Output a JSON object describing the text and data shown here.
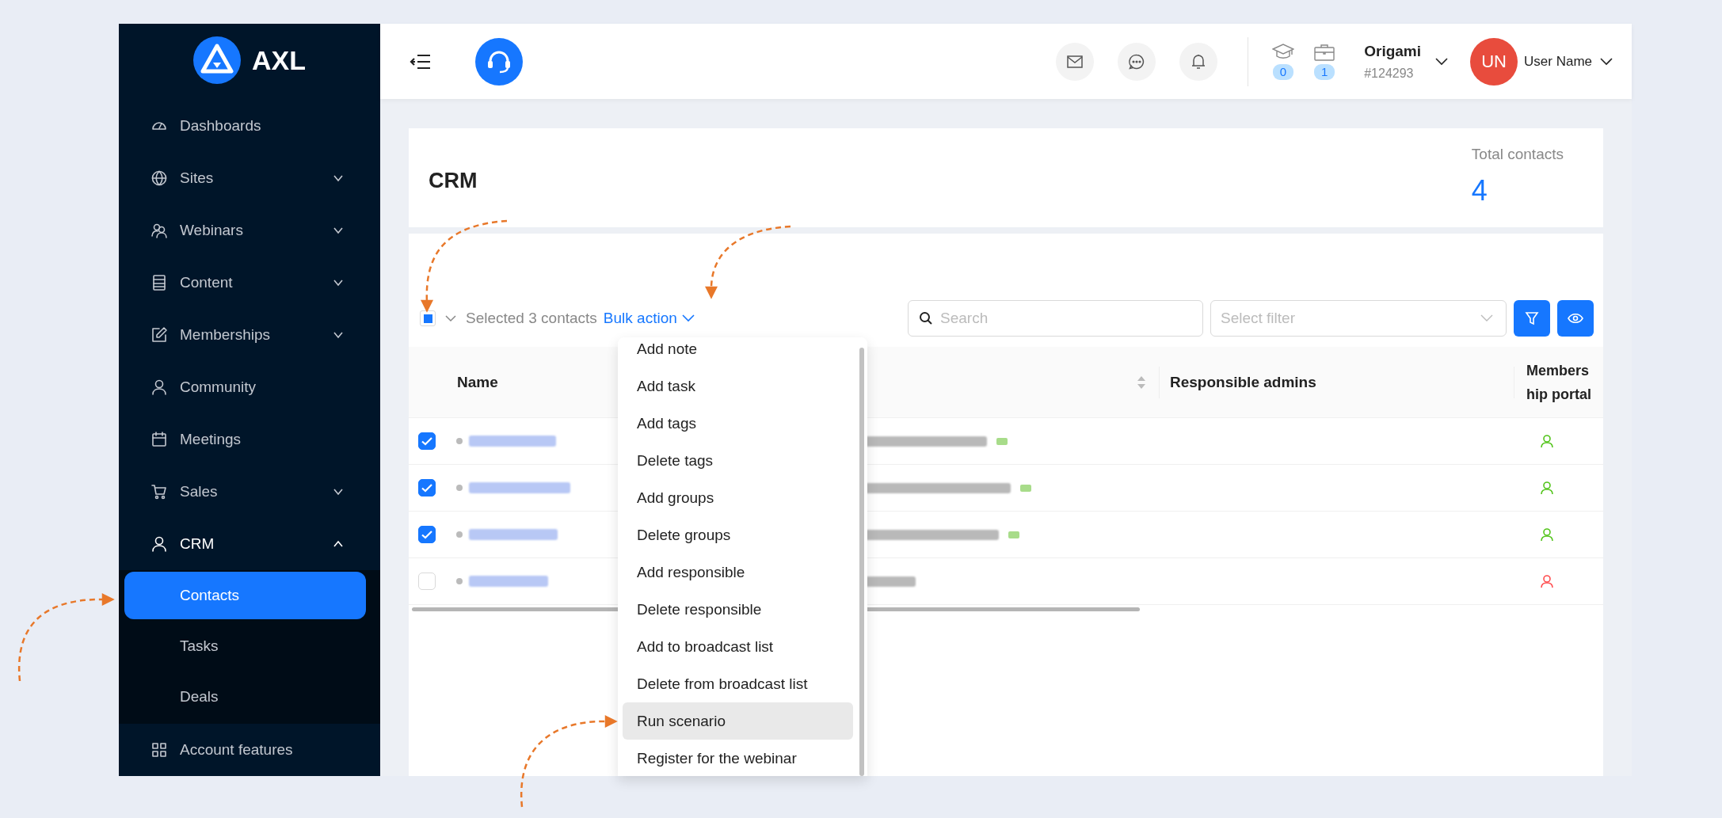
{
  "sidebar": {
    "logo": "AXL",
    "items": [
      {
        "label": "Dashboards"
      },
      {
        "label": "Sites",
        "expanded": false
      },
      {
        "label": "Webinars",
        "expanded": false
      },
      {
        "label": "Content",
        "expanded": false
      },
      {
        "label": "Memberships",
        "expanded": false
      },
      {
        "label": "Community"
      },
      {
        "label": "Meetings"
      },
      {
        "label": "Sales",
        "expanded": false
      },
      {
        "label": "CRM",
        "expanded": true,
        "children": [
          {
            "label": "Contacts",
            "selected": true
          },
          {
            "label": "Tasks",
            "selected": false
          },
          {
            "label": "Deals",
            "selected": false
          }
        ]
      },
      {
        "label": "Account features"
      }
    ]
  },
  "header": {
    "counters": [
      "0",
      "1"
    ],
    "company": {
      "name": "Origami",
      "id": "#124293"
    },
    "user": {
      "initials": "UN",
      "name": "User Name"
    }
  },
  "page": {
    "title": "CRM",
    "total_label": "Total contacts",
    "total_value": "4"
  },
  "toolbar": {
    "select_all_indeterminate": true,
    "selection_text": "Selected 3 contacts",
    "bulk_action": "Bulk action",
    "search": {
      "placeholder": "Search"
    },
    "filter": {
      "placeholder": "Select filter"
    }
  },
  "table": {
    "columns": [
      {
        "label": "Name"
      },
      {
        "sortable": true
      },
      {
        "label": "Responsible admins"
      },
      {
        "label": "Membership portal"
      }
    ],
    "rows": [
      {
        "checked": true,
        "verified": true,
        "portal_active": true
      },
      {
        "checked": true,
        "verified": true,
        "portal_active": true
      },
      {
        "checked": true,
        "verified": true,
        "portal_active": true
      },
      {
        "checked": false,
        "verified": false,
        "portal_active": false
      }
    ]
  },
  "bulk_menu": {
    "items": [
      {
        "label": "Add note",
        "highlighted": false
      },
      {
        "label": "Add task",
        "highlighted": false
      },
      {
        "label": "Add tags",
        "highlighted": false
      },
      {
        "label": "Delete tags",
        "highlighted": false
      },
      {
        "label": "Add groups",
        "highlighted": false
      },
      {
        "label": "Delete groups",
        "highlighted": false
      },
      {
        "label": "Add responsible",
        "highlighted": false
      },
      {
        "label": "Delete responsible",
        "highlighted": false
      },
      {
        "label": "Add to broadcast list",
        "highlighted": false
      },
      {
        "label": "Delete from broadcast list",
        "highlighted": false
      },
      {
        "label": "Run scenario",
        "highlighted": true
      },
      {
        "label": "Register for the webinar",
        "highlighted": false
      }
    ]
  }
}
